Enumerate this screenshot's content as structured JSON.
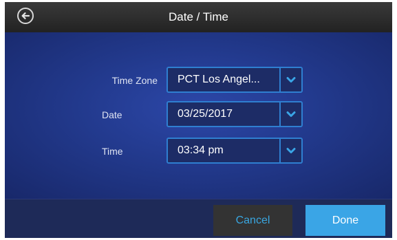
{
  "header": {
    "title": "Date / Time",
    "back_icon": "back-arrow-circle-icon"
  },
  "form": {
    "timezone": {
      "label": "Time Zone",
      "value": "PCT Los Angel..."
    },
    "date": {
      "label": "Date",
      "value": "03/25/2017"
    },
    "time": {
      "label": "Time",
      "value": "03:34 pm"
    },
    "dropdown_icon": "chevron-down-icon"
  },
  "footer": {
    "cancel_label": "Cancel",
    "done_label": "Done"
  },
  "colors": {
    "background": "#1b2a63",
    "accent": "#3aa5e6",
    "field_border": "#2f7fd1",
    "header": "#2c2c2c"
  }
}
